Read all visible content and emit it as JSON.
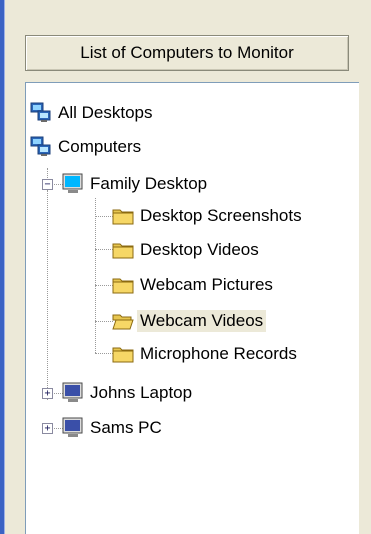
{
  "header": {
    "title": "List of Computers to Monitor"
  },
  "tree": {
    "all_desktops": "All Desktops",
    "computers": "Computers",
    "family_desktop": "Family Desktop",
    "folders": [
      "Desktop Screenshots",
      "Desktop Videos",
      "Webcam Pictures",
      "Webcam Videos",
      "Microphone Records"
    ],
    "selected_folder": "Webcam Videos",
    "johns_laptop": "Johns Laptop",
    "sams_pc": "Sams PC"
  },
  "icons": {
    "group": "desktop-group-icon",
    "computer": "computer-monitor-icon",
    "folder": "folder-icon",
    "folder_open": "folder-open-icon"
  },
  "colors": {
    "window_bg": "#ece9d8",
    "tree_bg": "#ffffff",
    "border_blue": "#3b63c4",
    "selection": "#ece9d8"
  }
}
